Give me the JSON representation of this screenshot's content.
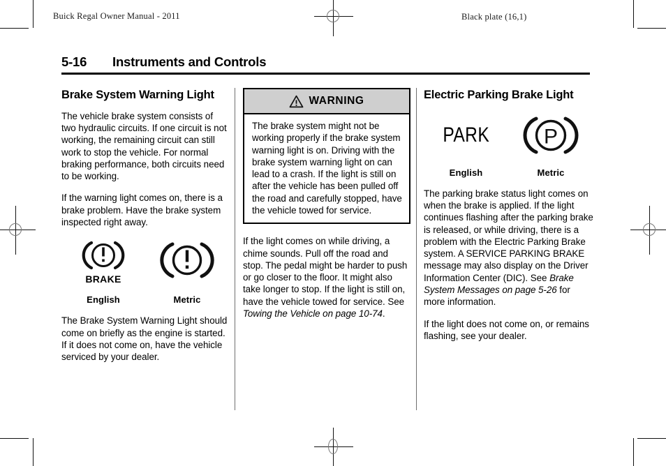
{
  "page": {
    "running_head_left": "Buick Regal Owner Manual - 2011",
    "running_head_right": "Black plate (16,1)",
    "page_number": "5-16",
    "chapter_title": "Instruments and Controls"
  },
  "column1": {
    "heading": "Brake System Warning Light",
    "paragraph1": "The vehicle brake system consists of two hydraulic circuits. If one circuit is not working, the remaining circuit can still work to stop the vehicle. For normal braking performance, both circuits need to be working.",
    "paragraph2": "If the warning light comes on, there is a brake problem. Have the brake system inspected right away.",
    "figure": {
      "name": "brake-system-warning-light-symbols",
      "english_symbol_text": "BRAKE",
      "english_label": "English",
      "metric_label": "Metric"
    },
    "paragraph3": "The Brake System Warning Light should come on briefly as the engine is started. If it does not come on, have the vehicle serviced by your dealer."
  },
  "column2": {
    "warning": {
      "icon": "warning-triangle-icon",
      "label": "WARNING",
      "text": "The brake system might not be working properly if the brake system warning light is on. Driving with the brake system warning light on can lead to a crash. If the light is still on after the vehicle has been pulled off the road and carefully stopped, have the vehicle towed for service."
    },
    "paragraph1_part1": "If the light comes on while driving, a chime sounds. Pull off the road and stop. The pedal might be harder to push or go closer to the floor. It might also take longer to stop. If the light is still on, have the vehicle towed for service. See ",
    "paragraph1_xref": "Towing the Vehicle on page 10-74",
    "paragraph1_part2": "."
  },
  "column3": {
    "heading": "Electric Parking Brake Light",
    "figure": {
      "name": "electric-parking-brake-light-symbols",
      "english_symbol_text": "PARK",
      "metric_symbol_text": "P",
      "english_label": "English",
      "metric_label": "Metric"
    },
    "paragraph1_part1": "The parking brake status light comes on when the brake is applied. If the light continues flashing after the parking brake is released, or while driving, there is a problem with the Electric Parking Brake system. A SERVICE PARKING BRAKE message may also display on the Driver Information Center (DIC). See ",
    "paragraph1_xref": "Brake System Messages on page 5-26",
    "paragraph1_part2": " for more information.",
    "paragraph2": "If the light does not come on, or remains flashing, see your dealer."
  },
  "colors": {
    "warning_header_background": "#cfcfcf",
    "text": "#000000",
    "rule": "#000000"
  }
}
